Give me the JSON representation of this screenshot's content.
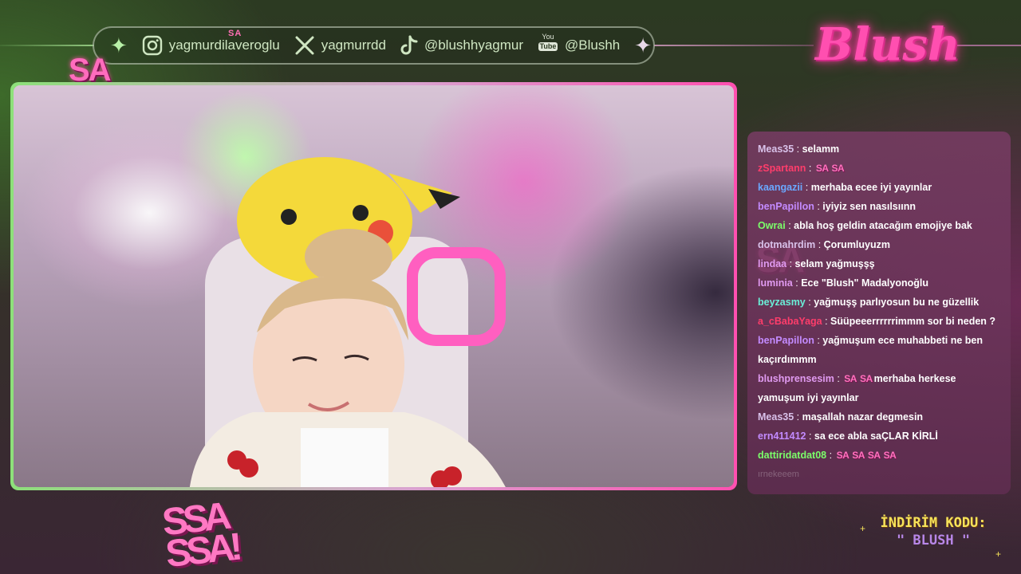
{
  "socials": {
    "instagram": "yagmurdilaveroglu",
    "twitter": "yagmurrdd",
    "tiktok": "@blushhyagmur",
    "youtube": "@Blushh",
    "youtube_top": "You",
    "youtube_bottom": "Tube",
    "sa_mini": "SA"
  },
  "brand": {
    "logo_text": "Blush"
  },
  "overlay": {
    "sa_top": "SA",
    "sa_cam": "SA",
    "sa_stack_1": "SSA",
    "sa_stack_2": "SSA!"
  },
  "chat": {
    "messages": [
      {
        "user": "Meas35",
        "color": "#d9c2ea",
        "text": "selamm"
      },
      {
        "user": "zSpartann",
        "color": "#ff3d6b",
        "text": "",
        "emotes": [
          "SA",
          "SA"
        ]
      },
      {
        "user": "kaangazii",
        "color": "#6aa8ff",
        "text": "merhaba ecee iyi yayınlar"
      },
      {
        "user": "benPapillon",
        "color": "#c38bff",
        "text": "iyiyiz sen nasılsıınn"
      },
      {
        "user": "Owrai",
        "color": "#7bff6a",
        "text": "abla hoş geldin atacağım emojiye bak"
      },
      {
        "user": "dotmahrdim",
        "color": "#d9c2ea",
        "text": "Çorumluyuzm"
      },
      {
        "user": "lindaa",
        "color": "#e09af0",
        "text": "selam yağmuşşş"
      },
      {
        "user": "luminia",
        "color": "#e09af0",
        "text": "Ece \"Blush\" Madalyonoğlu"
      },
      {
        "user": "beyzasmy",
        "color": "#6af0d8",
        "text": "yağmuşş parlıyosun bu ne güzellik"
      },
      {
        "user": "a_cBabaYaga",
        "color": "#ff3d6b",
        "text": "Süüpeeerrrrrrimmm sor bi neden ?"
      },
      {
        "user": "benPapillon",
        "color": "#c38bff",
        "text": "yağmuşum ece muhabbeti ne ben kaçırdımmm"
      },
      {
        "user": "blushprensesim",
        "color": "#e09af0",
        "text": "merhaba herkese yamuşum iyi yayınlar",
        "emotes": [
          "SA",
          "SA"
        ]
      },
      {
        "user": "Meas35",
        "color": "#d9c2ea",
        "text": "maşallah nazar degmesin"
      },
      {
        "user": "ern411412",
        "color": "#c38bff",
        "text": "sa ece abla saÇLAR KİRLİ"
      },
      {
        "user": "dattiridatdat08",
        "color": "#7bff6a",
        "text": "",
        "emotes": [
          "SA",
          "SA",
          "SA",
          "SA"
        ]
      }
    ],
    "faded_line": "ırnekeeem"
  },
  "promo": {
    "title": "İNDİRİM KODU:",
    "code": "\" BLUSH \""
  }
}
